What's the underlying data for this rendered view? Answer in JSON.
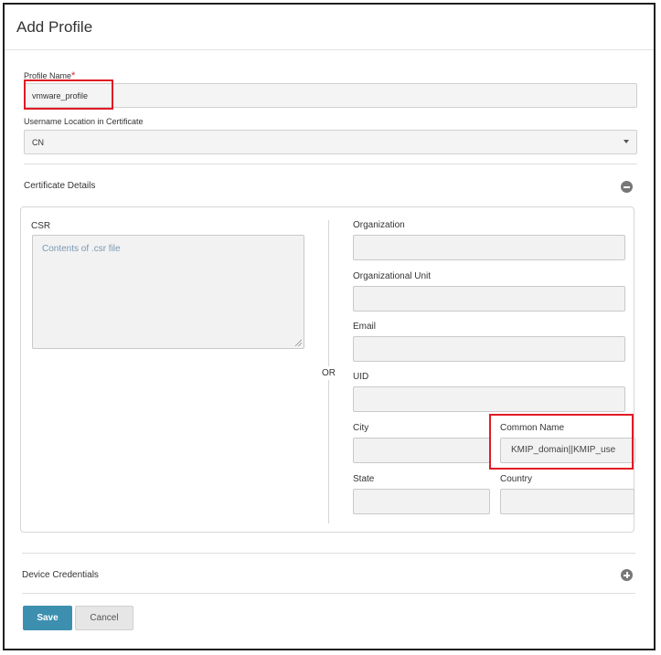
{
  "dialog": {
    "title": "Add Profile"
  },
  "profile_name": {
    "label": "Profile Name",
    "required_mark": "*",
    "value": "vmware_profile"
  },
  "username_location": {
    "label": "Username Location in Certificate",
    "value": "CN"
  },
  "certificate_details": {
    "title": "Certificate Details",
    "toggle_icon": "minus-circle-icon",
    "csr": {
      "label": "CSR",
      "placeholder": "Contents of .csr file"
    },
    "or_text": "OR",
    "fields": {
      "organization": {
        "label": "Organization",
        "value": ""
      },
      "organizational_unit": {
        "label": "Organizational Unit",
        "value": ""
      },
      "email": {
        "label": "Email",
        "value": ""
      },
      "uid": {
        "label": "UID",
        "value": ""
      },
      "city": {
        "label": "City",
        "value": ""
      },
      "common_name": {
        "label": "Common Name",
        "value": "KMIP_domain||KMIP_use"
      },
      "state": {
        "label": "State",
        "value": ""
      },
      "country": {
        "label": "Country",
        "value": ""
      }
    }
  },
  "device_credentials": {
    "title": "Device Credentials",
    "toggle_icon": "plus-circle-icon"
  },
  "footer": {
    "save_label": "Save",
    "cancel_label": "Cancel"
  },
  "colors": {
    "primary_button": "#3d8fb0",
    "highlight": "#e01b24",
    "placeholder_text": "#7a99b3"
  }
}
